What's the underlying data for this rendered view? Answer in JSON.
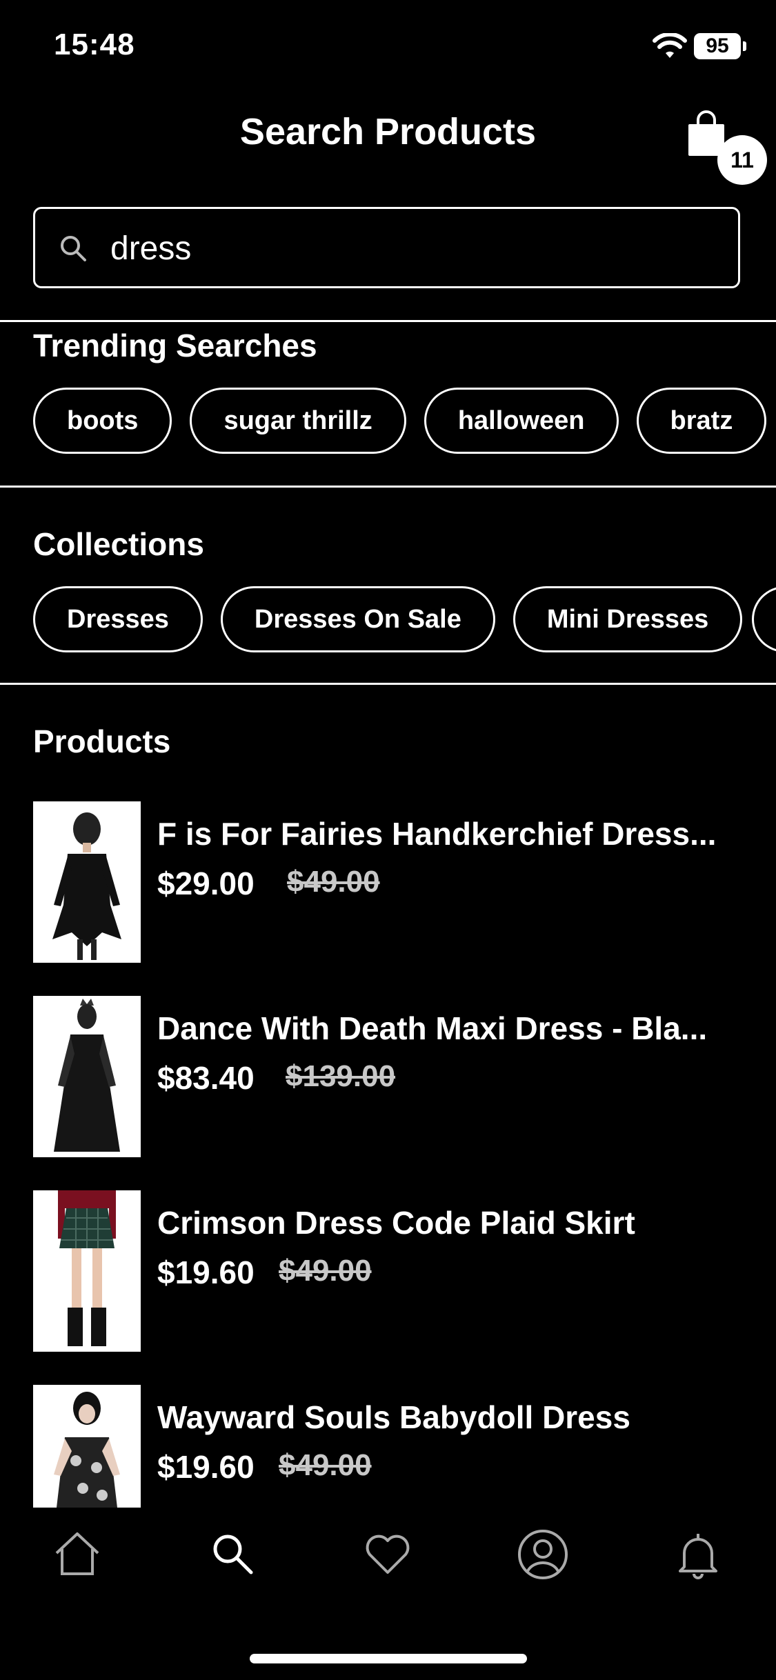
{
  "status_bar": {
    "time": "15:48",
    "battery": "95"
  },
  "header": {
    "title": "Search Products",
    "cart_count": "11"
  },
  "search": {
    "value": "dress",
    "placeholder": ""
  },
  "trending": {
    "title": "Trending Searches",
    "chips": [
      "boots",
      "sugar thrillz",
      "halloween",
      "bratz"
    ]
  },
  "collections": {
    "title": "Collections",
    "chips": [
      "Dresses",
      "Dresses On Sale",
      "Mini Dresses"
    ]
  },
  "products": {
    "title": "Products",
    "items": [
      {
        "name": "F is For Fairies Handkerchief Dress...",
        "price": "$29.00",
        "old_price": "$49.00"
      },
      {
        "name": "Dance With Death Maxi Dress - Bla...",
        "price": "$83.40",
        "old_price": "$139.00"
      },
      {
        "name": "Crimson Dress Code Plaid Skirt",
        "price": "$19.60",
        "old_price": "$49.00"
      },
      {
        "name": "Wayward Souls Babydoll Dress",
        "price": "$19.60",
        "old_price": "$49.00"
      }
    ]
  },
  "tabs": [
    "home-icon",
    "search-icon",
    "heart-icon",
    "profile-icon",
    "bell-icon"
  ]
}
